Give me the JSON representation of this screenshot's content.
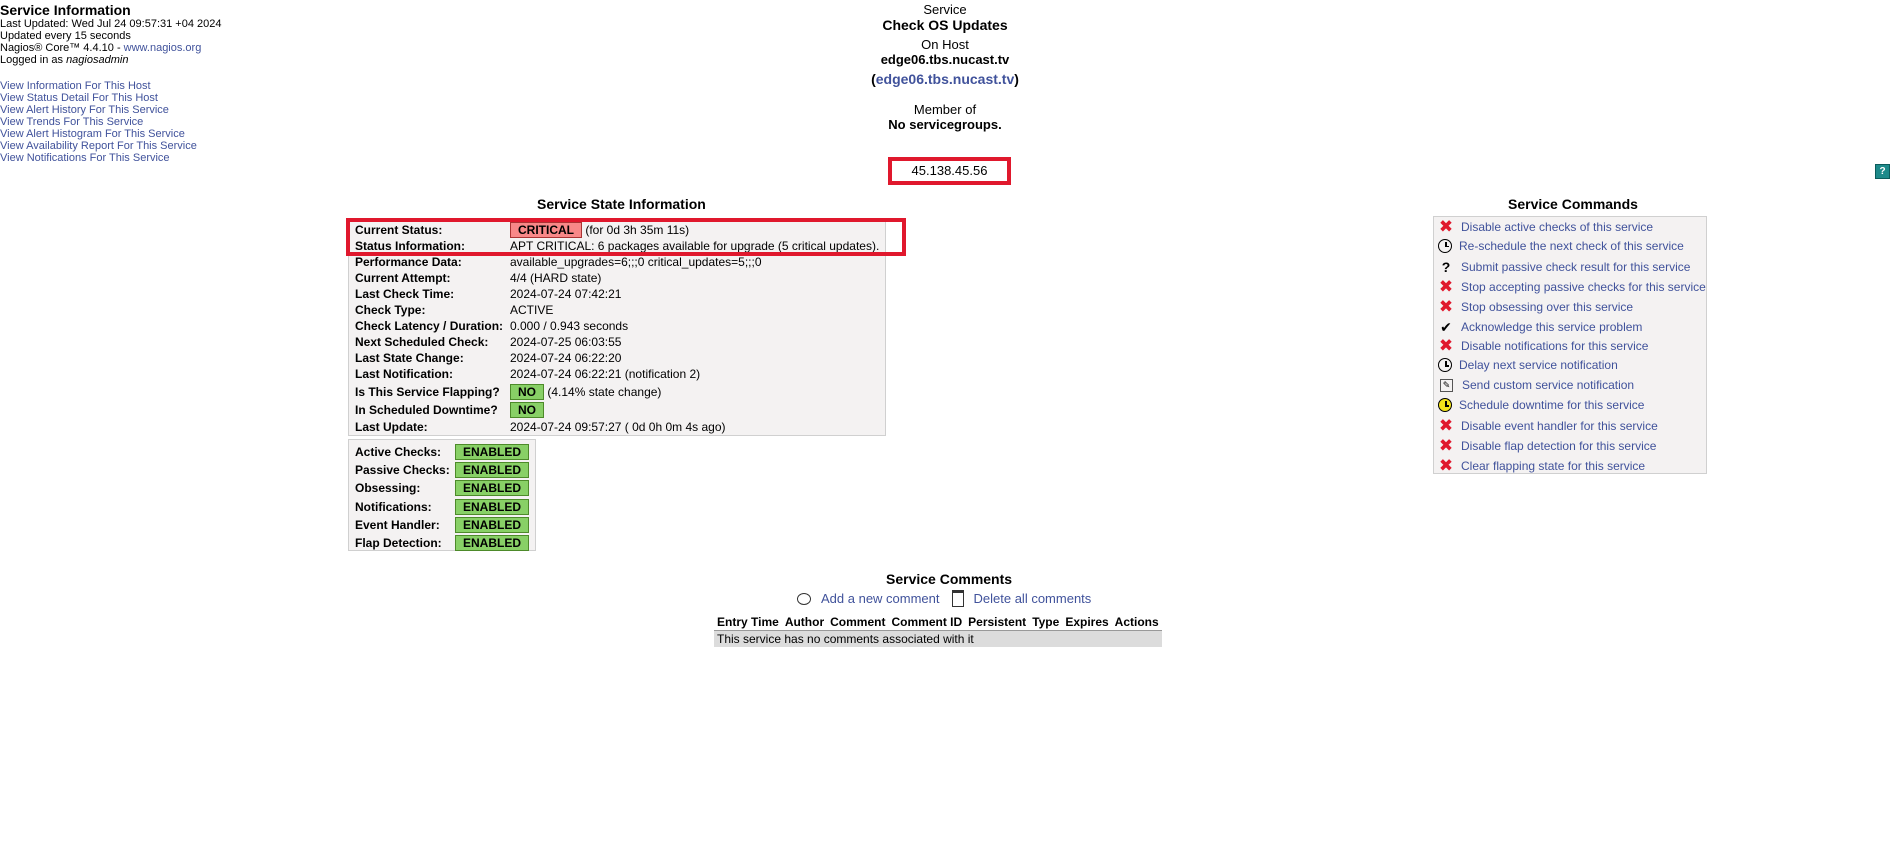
{
  "info": {
    "title": "Service Information",
    "last_updated": "Last Updated: Wed Jul 24 09:57:31 +04 2024",
    "update_interval": "Updated every 15 seconds",
    "version_prefix": "Nagios® Core™ 4.4.10 - ",
    "version_link": "www.nagios.org",
    "logged_in_prefix": "Logged in as ",
    "logged_in_user": "nagiosadmin"
  },
  "nav_links": [
    "View Information For This Host",
    "View Status Detail For This Host",
    "View Alert History For This Service",
    "View Trends For This Service",
    "View Alert Histogram For This Service",
    "View Availability Report For This Service",
    "View Notifications For This Service"
  ],
  "header": {
    "service_label": "Service",
    "service_name": "Check OS Updates",
    "host_label": "On Host",
    "host_name": "edge06.tbs.nucast.tv",
    "host_address": "edge06.tbs.nucast.tv",
    "member_label": "Member of",
    "groups": "No servicegroups.",
    "ip": "45.138.45.56"
  },
  "help_icon": "?",
  "state": {
    "title": "Service State Information",
    "rows": [
      {
        "k": "Current Status:",
        "badge": "CRITICAL",
        "v": "(for 0d 3h 35m 11s)"
      },
      {
        "k": "Status Information:",
        "v": "APT CRITICAL: 6 packages available for upgrade (5 critical updates)."
      },
      {
        "k": "Performance Data:",
        "v": "available_upgrades=6;;;0 critical_updates=5;;;0"
      },
      {
        "k": "Current Attempt:",
        "v": "4/4  (HARD state)"
      },
      {
        "k": "Last Check Time:",
        "v": "2024-07-24 07:42:21"
      },
      {
        "k": "Check Type:",
        "v": "ACTIVE"
      },
      {
        "k": "Check Latency / Duration:",
        "v": "0.000 / 0.943 seconds"
      },
      {
        "k": "Next Scheduled Check:",
        "v": "2024-07-25 06:03:55"
      },
      {
        "k": "Last State Change:",
        "v": "2024-07-24 06:22:20"
      },
      {
        "k": "Last Notification:",
        "v": "2024-07-24 06:22:21 (notification 2)"
      },
      {
        "k": "Is This Service Flapping?",
        "badge": "NO",
        "v": "(4.14% state change)"
      },
      {
        "k": "In Scheduled Downtime?",
        "badge": "NO",
        "v": ""
      },
      {
        "k": "Last Update:",
        "v": "2024-07-24 09:57:27  ( 0d 0h 0m 4s ago)"
      }
    ]
  },
  "checks": [
    {
      "k": "Active Checks:",
      "v": "ENABLED"
    },
    {
      "k": "Passive Checks:",
      "v": "ENABLED"
    },
    {
      "k": "Obsessing:",
      "v": "ENABLED"
    },
    {
      "k": "Notifications:",
      "v": "ENABLED"
    },
    {
      "k": "Event Handler:",
      "v": "ENABLED"
    },
    {
      "k": "Flap Detection:",
      "v": "ENABLED"
    }
  ],
  "commands": {
    "title": "Service Commands",
    "items": [
      {
        "icon": "x",
        "label": "Disable active checks of this service"
      },
      {
        "icon": "clock",
        "label": "Re-schedule the next check of this service"
      },
      {
        "icon": "question",
        "label": "Submit passive check result for this service"
      },
      {
        "icon": "x",
        "label": "Stop accepting passive checks for this service"
      },
      {
        "icon": "x",
        "label": "Stop obsessing over this service"
      },
      {
        "icon": "check",
        "label": "Acknowledge this service problem"
      },
      {
        "icon": "x",
        "label": "Disable notifications for this service"
      },
      {
        "icon": "clock",
        "label": "Delay next service notification"
      },
      {
        "icon": "note",
        "label": "Send custom service notification"
      },
      {
        "icon": "clock-yellow",
        "label": "Schedule downtime for this service"
      },
      {
        "icon": "x",
        "label": "Disable event handler for this service"
      },
      {
        "icon": "x",
        "label": "Disable flap detection for this service"
      },
      {
        "icon": "x",
        "label": "Clear flapping state for this service"
      }
    ]
  },
  "comments": {
    "title": "Service Comments",
    "add_label": "Add a new comment",
    "delete_label": "Delete all comments",
    "columns": [
      "Entry Time",
      "Author",
      "Comment",
      "Comment ID",
      "Persistent",
      "Type",
      "Expires",
      "Actions"
    ],
    "empty": "This service has no comments associated with it"
  },
  "colors": {
    "critical": "#f88888",
    "ok": "#88d066",
    "highlight": "#e0182d",
    "link": "#40529b"
  }
}
